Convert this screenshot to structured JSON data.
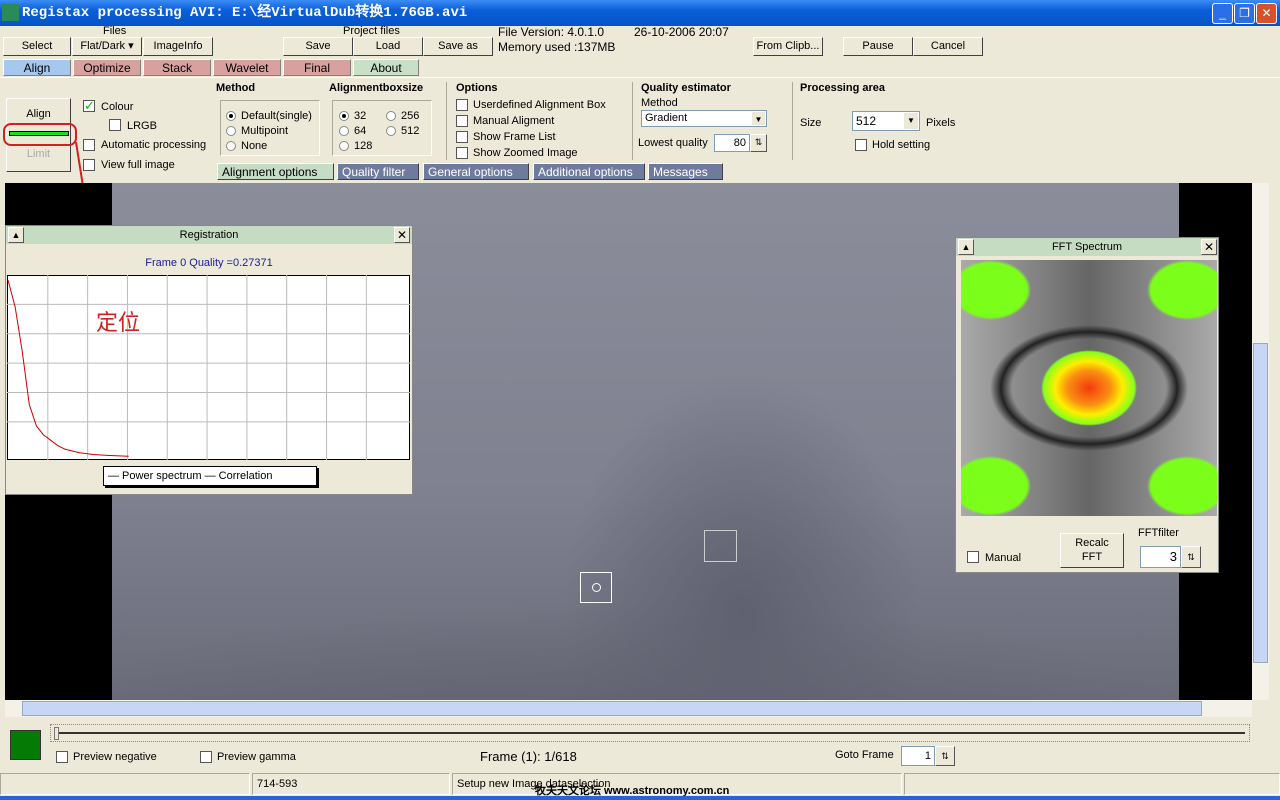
{
  "window": {
    "title": "Registax processing AVI: E:\\经VirtualDub转换1.76GB.avi",
    "app_icon_text": "Regi Stax"
  },
  "toolbar": {
    "files_label": "Files",
    "project_files_label": "Project files",
    "select": "Select",
    "flatdark": "Flat/Dark ▾",
    "imageinfo": "ImageInfo",
    "save": "Save",
    "load": "Load",
    "save_as": "Save as",
    "file_version": "File Version: 4.0.1.0",
    "date": "26-10-2006 20:07",
    "memory": "Memory used :137MB",
    "from_clip": "From Clipb...",
    "pause": "Pause",
    "cancel": "Cancel"
  },
  "tabs": [
    {
      "label": "Align",
      "color": "#a6c8ee"
    },
    {
      "label": "Optimize",
      "color": "#d9a0a0"
    },
    {
      "label": "Stack",
      "color": "#d9a0a0"
    },
    {
      "label": "Wavelet",
      "color": "#d9a0a0"
    },
    {
      "label": "Final",
      "color": "#d9a0a0"
    },
    {
      "label": "About",
      "color": "#c8e0c8"
    }
  ],
  "align_panel": {
    "align_button": "Align",
    "limit_button": "Limit",
    "colour": "Colour",
    "colour_checked": true,
    "lrgb": "LRGB",
    "auto_processing": "Automatic processing",
    "view_full": "View full image"
  },
  "method": {
    "title": "Method",
    "options": [
      "Default(single)",
      "Multipoint",
      "None"
    ],
    "selected": "Default(single)"
  },
  "boxsize": {
    "title": "Alignmentboxsize",
    "options": [
      "32",
      "256",
      "64",
      "512",
      "128"
    ],
    "selected": "32"
  },
  "options": {
    "title": "Options",
    "items": [
      "Userdefined Alignment Box",
      "Manual Aligment",
      "Show Frame List",
      "Show Zoomed Image"
    ]
  },
  "quality": {
    "title": "Quality estimator",
    "method_label": "Method",
    "method_value": "Gradient",
    "lowest_label": "Lowest quality",
    "lowest_value": "80"
  },
  "processing_area": {
    "title": "Processing area",
    "size_label": "Size",
    "size_value": "512",
    "pixels": "Pixels",
    "hold": "Hold setting"
  },
  "subtabs": [
    "Alignment  options",
    "Quality  filter",
    "General options",
    "Additional options",
    "Messages"
  ],
  "registration": {
    "title": "Registration",
    "quality_text": "Frame 0 Quality =0.27371",
    "legend": "— Power spectrum — Correlation",
    "annotation": "定位"
  },
  "fft": {
    "title": "FFT Spectrum",
    "manual": "Manual",
    "recalc": "Recalc FFT",
    "filter_label": "FFTfilter",
    "filter_value": "3"
  },
  "bottom": {
    "preview_negative": "Preview negative",
    "preview_gamma": "Preview gamma",
    "frame_text": "Frame (1): 1/618",
    "goto_label": "Goto Frame",
    "goto_value": "1"
  },
  "statusbar": {
    "coords": "714-593",
    "message": "Setup new Image dataselection",
    "watermark": "牧夫天文论坛 www.astronomy.com.cn"
  },
  "chart_data": {
    "type": "line",
    "title": "Frame 0 Quality =0.27371",
    "series": [
      {
        "name": "Power spectrum",
        "color": "#cc0000",
        "x": [
          0,
          1,
          2,
          3,
          4,
          5,
          6,
          7,
          8,
          9,
          10,
          12,
          14,
          17
        ],
        "y": [
          100,
          85,
          60,
          30,
          18,
          13,
          10,
          7,
          5,
          4,
          3,
          2,
          1.5,
          1
        ]
      },
      {
        "name": "Correlation",
        "color": "#000080",
        "x": [],
        "y": []
      }
    ],
    "grid": true,
    "legend": "bottom"
  }
}
